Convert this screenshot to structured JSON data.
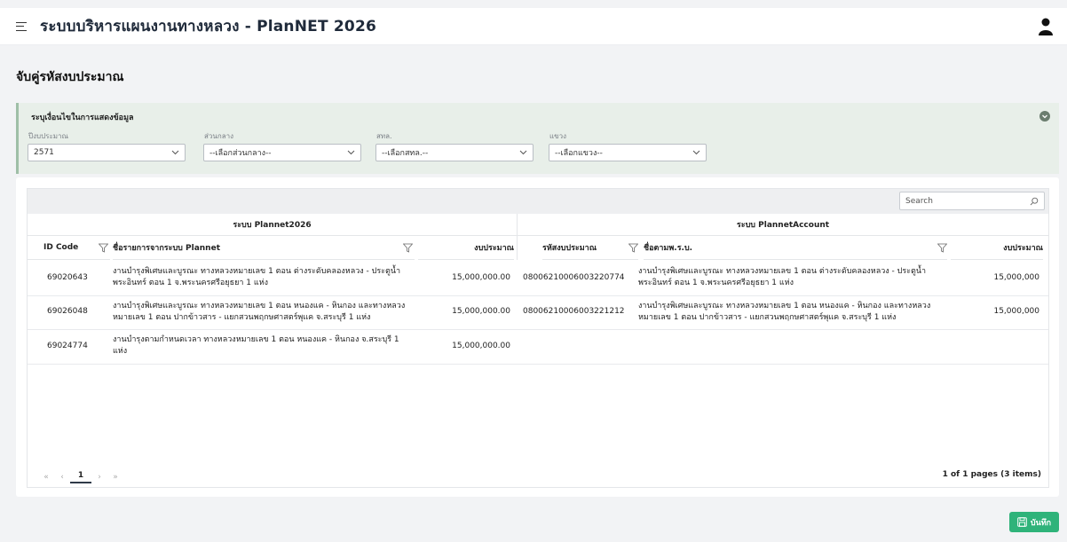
{
  "app": {
    "title": "ระบบบริหารแผนงานทางหลวง - PlanNET 2026"
  },
  "page": {
    "title": "จับคู่รหัสงบประมาณ"
  },
  "filters": {
    "title": "ระบุเงื่อนไขในการแสดงข้อมูล",
    "fiscal_year": {
      "label": "ปีงบประมาณ",
      "value": "2571"
    },
    "central": {
      "label": "ส่วนกลาง",
      "value": "--เลือกส่วนกลาง--"
    },
    "district": {
      "label": "สทล.",
      "value": "--เลือกสทล.--"
    },
    "branch": {
      "label": "แขวง",
      "value": "--เลือกแขวง--"
    }
  },
  "table": {
    "search_placeholder": "Search",
    "group_left": "ระบบ Plannet2026",
    "group_right": "ระบบ PlannetAccount",
    "columns": [
      "ID Code",
      "ชื่อรายการจากระบบ Plannet",
      "งบประมาณ",
      "รหัสงบประมาณ",
      "ชื่อตามพ.ร.บ.",
      "งบประมาณ"
    ],
    "rows": [
      {
        "id": "69020643",
        "name": "งานบำรุงพิเศษและบูรณะ ทางหลวงหมายเลข 1 ตอน ต่างระดับคลองหลวง - ประตูน้ำพระอินทร์ ตอน 1 จ.พระนครศรีอยุธยา 1 แห่ง",
        "budget": "15,000,000.00",
        "code": "08006210006003220774",
        "act_name": "งานบำรุงพิเศษและบูรณะ ทางหลวงหมายเลข 1 ตอน ต่างระดับคลองหลวง - ประตูน้ำพระอินทร์ ตอน 1 จ.พระนครศรีอยุธยา 1 แห่ง",
        "act_budget": "15,000,000"
      },
      {
        "id": "69026048",
        "name": "งานบำรุงพิเศษและบูรณะ ทางหลวงหมายเลข 1 ตอน หนองแค - หินกอง และทางหลวงหมายเลข 1 ตอน ปากข้าวสาร - แยกสวนพฤกษศาสตร์พุแค จ.สระบุรี 1 แห่ง",
        "budget": "15,000,000.00",
        "code": "08006210006003221212",
        "act_name": "งานบำรุงพิเศษและบูรณะ ทางหลวงหมายเลข 1 ตอน หนองแค - หินกอง และทางหลวงหมายเลข 1 ตอน ปากข้าวสาร - แยกสวนพฤกษศาสตร์พุแค จ.สระบุรี 1 แห่ง",
        "act_budget": "15,000,000"
      },
      {
        "id": "69024774",
        "name": "งานบำรุงตามกำหนดเวลา ทางหลวงหมายเลข 1 ตอน หนองแค - หินกอง จ.สระบุรี 1 แห่ง",
        "budget": "15,000,000.00",
        "code": "",
        "act_name": "",
        "act_budget": ""
      }
    ],
    "pager": {
      "first": "«",
      "prev": "‹",
      "current": "1",
      "next": "›",
      "last": "»"
    },
    "page_info": "1 of 1 pages (3 items)"
  },
  "actions": {
    "save_label": "บันทึก"
  },
  "colors": {
    "save": "#2fb37a",
    "panel": "#e8efe9"
  }
}
